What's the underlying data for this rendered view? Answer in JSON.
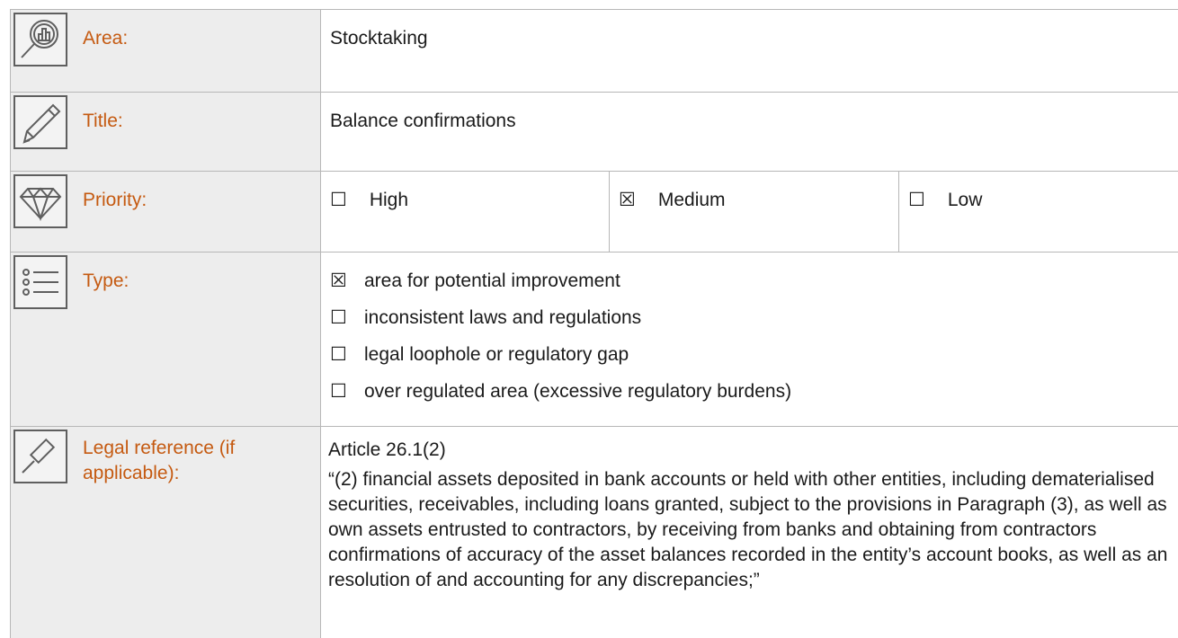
{
  "rows": {
    "area": {
      "label": "Area:",
      "value": "Stocktaking"
    },
    "title": {
      "label": "Title:",
      "value": "Balance confirmations"
    },
    "priority": {
      "label": "Priority:",
      "options": [
        {
          "box": "☐",
          "text": "High"
        },
        {
          "box": "☒",
          "text": "Medium"
        },
        {
          "box": "☐",
          "text": "Low"
        }
      ]
    },
    "type": {
      "label": "Type:",
      "options": [
        {
          "box": "☒",
          "text": "area for potential improvement"
        },
        {
          "box": "☐",
          "text": "inconsistent laws and regulations"
        },
        {
          "box": "☐",
          "text": "legal loophole or regulatory gap"
        },
        {
          "box": "☐",
          "text": "over regulated area (excessive regulatory burdens)"
        }
      ]
    },
    "legal": {
      "label_line1": "Legal reference (if",
      "label_line2": "applicable):",
      "reference": "Article 26.1(2)",
      "quote": "“(2) financial assets deposited in bank accounts or held with other entities, including dematerialised securities, receivables, including loans granted, subject to the provisions in Paragraph (3), as well as own assets entrusted to contractors, by receiving from banks and obtaining from contractors confirmations of accuracy of the asset balances recorded in the entity’s account books, as well as an resolution of and accounting for any discrepancies;”"
    }
  },
  "icons": [
    "magnifier-chart-icon",
    "pencil-icon",
    "diamond-icon",
    "list-icon",
    "gavel-icon"
  ],
  "colors": {
    "label": "#c55a11",
    "label_bg": "#ededed",
    "border": "#b7b7b7",
    "icon_stroke": "#5f5f5f"
  }
}
